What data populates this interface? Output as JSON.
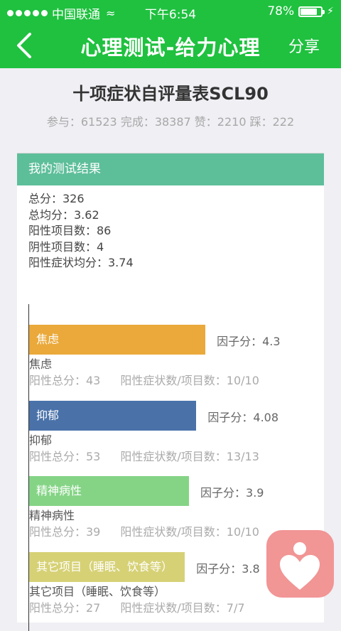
{
  "status_bar": {
    "carrier": "中国联通",
    "time": "下午6:54",
    "battery": "78%",
    "battery_level": 0.78
  },
  "nav": {
    "title": "心理测试-给力心理",
    "share_label": "分享",
    "back_icon": "chevron-left-icon"
  },
  "quiz": {
    "title": "十项症状自评量表SCL90",
    "stats": "参与：61523 完成：38387 赞：2210 踩：222"
  },
  "result": {
    "header": "我的测试结果",
    "summary": [
      "总分：326",
      "总均分：3.62",
      "阳性项目数：86",
      "阴性项目数：4",
      "阳性症状均分：3.74"
    ]
  },
  "chart_data": {
    "type": "bar",
    "orientation": "horizontal",
    "categories": [
      "焦虑",
      "抑郁",
      "精神病性",
      "其它项目（睡眠、饮食等）"
    ],
    "values": [
      4.3,
      4.08,
      3.9,
      3.8
    ],
    "colors": [
      "#eaa93a",
      "#4a72a9",
      "#85d486",
      "#d6d175"
    ],
    "factor_labels": [
      "因子分：4.3",
      "因子分：4.08",
      "因子分：3.9",
      "因子分：3.8"
    ],
    "details": [
      {
        "total": "阳性总分：43",
        "ratio": "阳性症状数/项目数：10/10"
      },
      {
        "total": "阳性总分：53",
        "ratio": "阳性症状数/项目数：13/13"
      },
      {
        "total": "阳性总分：39",
        "ratio": "阳性症状数/项目数：10/10"
      },
      {
        "total": "阳性总分：27",
        "ratio": "阳性症状数/项目数：7/7"
      }
    ]
  },
  "colors": {
    "nav_green": "#1fc13f",
    "card_header": "#5dbe9a",
    "logo_pink": "#f19595"
  }
}
